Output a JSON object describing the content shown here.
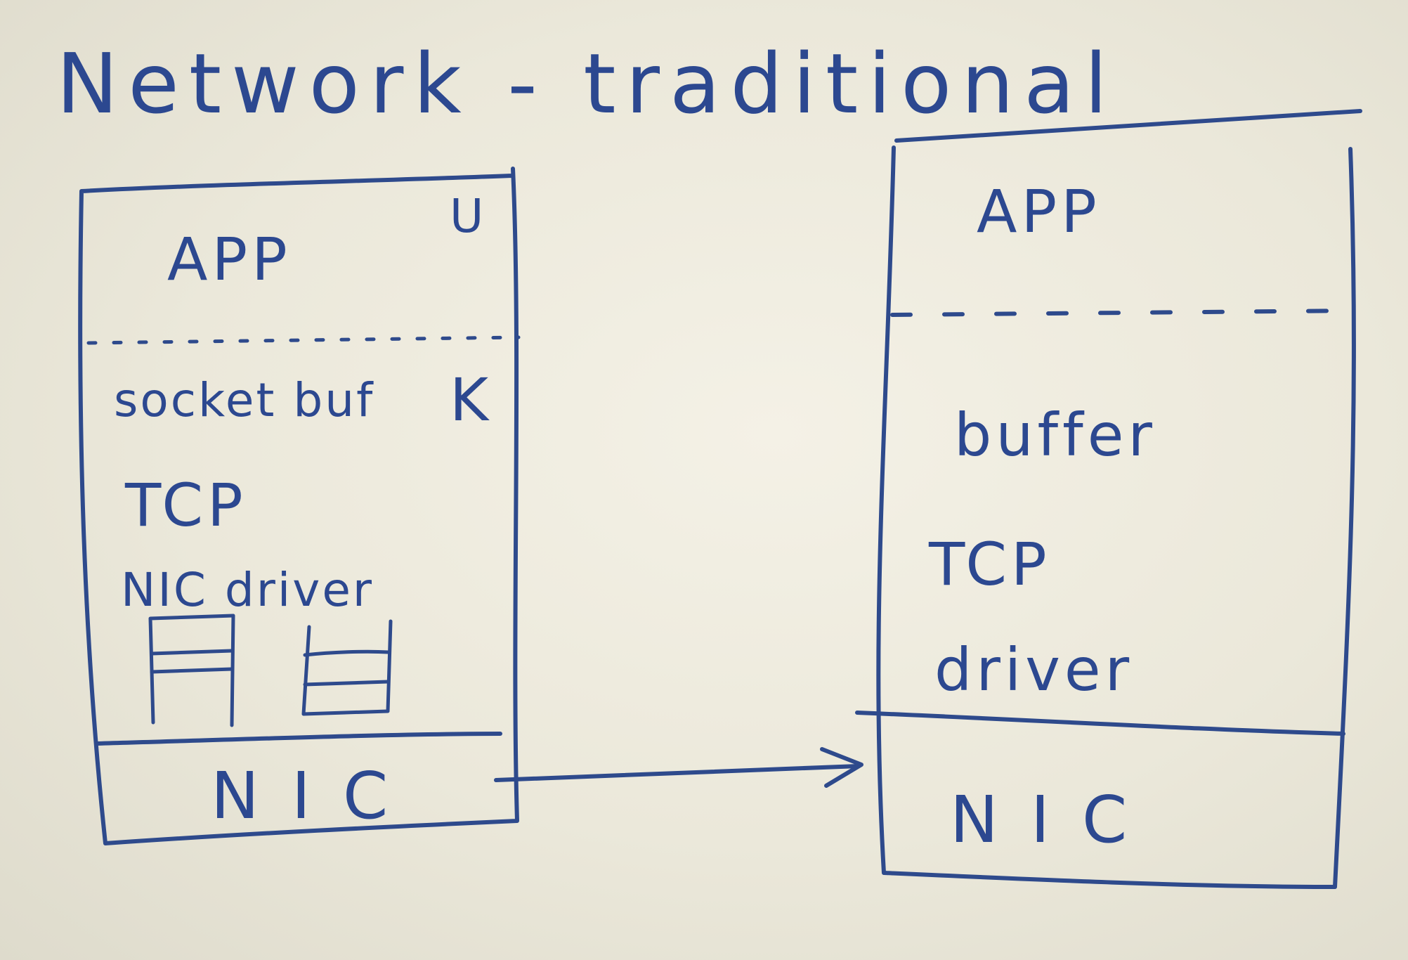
{
  "title": "Network - traditional",
  "sender": {
    "user_space": {
      "app": "APP",
      "mark": "U"
    },
    "kernel_space": {
      "mark": "K",
      "layers": [
        "socket buf",
        "TCP",
        "NIC driver"
      ]
    },
    "hardware": "NIC"
  },
  "receiver": {
    "user_space": {
      "app": "APP"
    },
    "kernel_space": {
      "layers": [
        "buffer",
        "TCP",
        "driver"
      ]
    },
    "hardware": "NIC"
  },
  "colors": {
    "ink": "#2e4a8c",
    "board": "#efece0"
  }
}
